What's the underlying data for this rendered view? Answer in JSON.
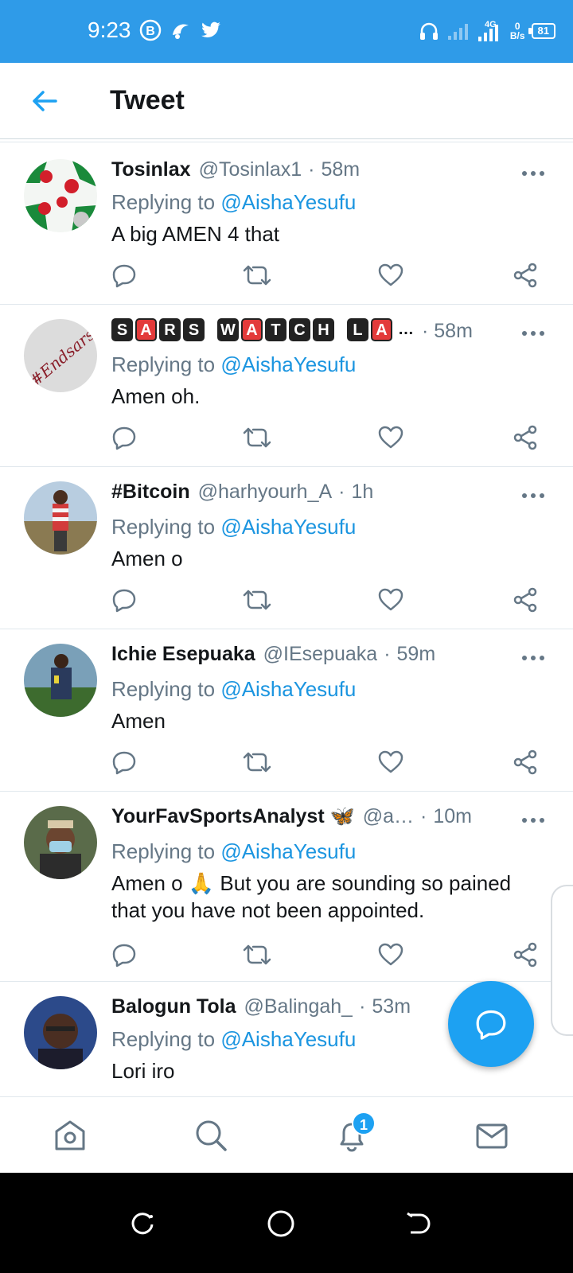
{
  "status_bar": {
    "time": "9:23",
    "network": "4G",
    "net_speed_value": "0",
    "net_speed_unit": "B/s",
    "battery": "81"
  },
  "header": {
    "title": "Tweet"
  },
  "tweets": [
    {
      "name": "Tosinlax",
      "handle": "@Tosinlax1",
      "time": "58m",
      "replying_prefix": "Replying to ",
      "replying_to": "@AishaYesufu",
      "text": "A big AMEN  4 that"
    },
    {
      "name": "SARS WATCH LA",
      "name_suffix": "…",
      "handle": "",
      "time": "58m",
      "replying_prefix": "Replying to ",
      "replying_to": "@AishaYesufu",
      "text": "Amen oh.",
      "avatar_text": "#Endsars"
    },
    {
      "name": "#Bitcoin",
      "handle": "@harhyourh_A",
      "time": "1h",
      "replying_prefix": "Replying to ",
      "replying_to": "@AishaYesufu",
      "text": "Amen o"
    },
    {
      "name": "Ichie Esepuaka",
      "handle": "@IEsepuaka",
      "time": "59m",
      "replying_prefix": "Replying to ",
      "replying_to": "@AishaYesufu",
      "text": "Amen"
    },
    {
      "name": "YourFavSportsAnalyst 🦋",
      "handle": "@a…",
      "time": "10m",
      "replying_prefix": "Replying to ",
      "replying_to": "@AishaYesufu",
      "text": "Amen o 🙏 But you are sounding so pained that you have not been appointed."
    },
    {
      "name": "Balogun Tola",
      "handle": "@Balingah_",
      "time": "53m",
      "replying_prefix": "Replying to ",
      "replying_to": "@AishaYesufu",
      "text": "Lori iro"
    }
  ],
  "bottom_nav": {
    "notifications_badge": "1"
  },
  "colors": {
    "accent": "#1da1f2",
    "status_bar": "#2f9be8",
    "secondary_text": "#657786",
    "mention": "#1b95e0"
  }
}
